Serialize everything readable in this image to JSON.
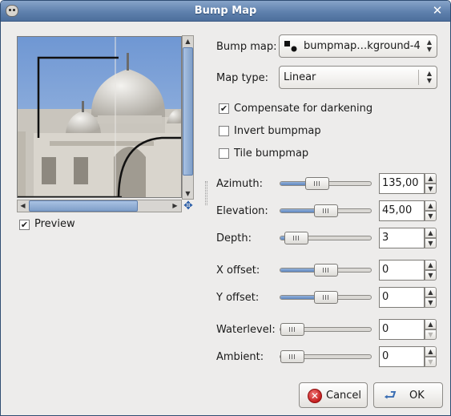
{
  "window": {
    "title": "Bump Map"
  },
  "preview": {
    "label": "Preview",
    "checked": true
  },
  "bump_map": {
    "label": "Bump map:",
    "value": "bumpmap…kground-4"
  },
  "map_type": {
    "label": "Map type:",
    "value": "Linear"
  },
  "options": [
    {
      "label": "Compensate for darkening",
      "checked": true
    },
    {
      "label": "Invert bumpmap",
      "checked": false
    },
    {
      "label": "Tile bumpmap",
      "checked": false
    }
  ],
  "params": [
    {
      "label": "Azimuth:",
      "value": "135,00",
      "level": 0.375
    },
    {
      "label": "Elevation:",
      "value": "45,00",
      "level": 0.5
    },
    {
      "label": "Depth:",
      "value": "3",
      "level": 0.06
    },
    {
      "label": "X offset:",
      "value": "0",
      "level": 0.5
    },
    {
      "label": "Y offset:",
      "value": "0",
      "level": 0.5
    },
    {
      "label": "Waterlevel:",
      "value": "0",
      "level": 0.0
    },
    {
      "label": "Ambient:",
      "value": "0",
      "level": 0.0
    }
  ],
  "buttons": {
    "cancel": "Cancel",
    "ok": "OK"
  },
  "colors": {
    "accent": "#5f86be",
    "titlebar": "#5f81ad"
  }
}
